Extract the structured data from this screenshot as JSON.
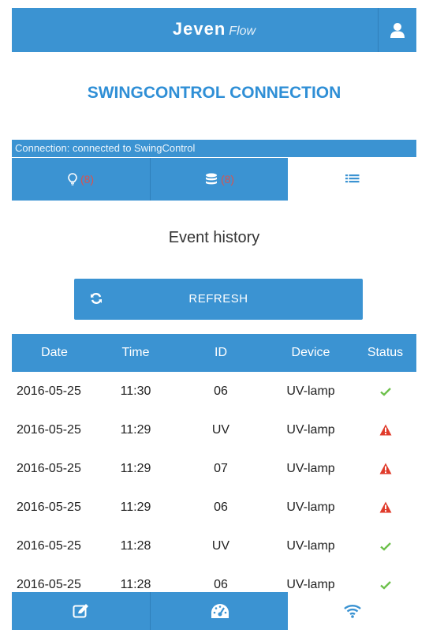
{
  "header": {
    "brand": "Jeven",
    "brand_sub": "Flow",
    "user_icon": "user-icon"
  },
  "page_title": "SWINGCONTROL CONNECTION",
  "connection_status": "Connection: connected to SwingControl",
  "tabs": [
    {
      "icon": "bulb-icon",
      "count": "(8)"
    },
    {
      "icon": "database-icon",
      "count": "(8)"
    },
    {
      "icon": "list-icon",
      "active": true
    }
  ],
  "section_title": "Event history",
  "refresh_label": "REFRESH",
  "table": {
    "headers": [
      "Date",
      "Time",
      "ID",
      "Device",
      "Status"
    ],
    "rows": [
      {
        "date": "2016-05-25",
        "time": "11:30",
        "id": "06",
        "device": "UV-lamp",
        "status": "ok"
      },
      {
        "date": "2016-05-25",
        "time": "11:29",
        "id": "UV",
        "device": "UV-lamp",
        "status": "warning"
      },
      {
        "date": "2016-05-25",
        "time": "11:29",
        "id": "07",
        "device": "UV-lamp",
        "status": "warning"
      },
      {
        "date": "2016-05-25",
        "time": "11:29",
        "id": "06",
        "device": "UV-lamp",
        "status": "warning"
      },
      {
        "date": "2016-05-25",
        "time": "11:28",
        "id": "UV",
        "device": "UV-lamp",
        "status": "ok"
      },
      {
        "date": "2016-05-25",
        "time": "11:28",
        "id": "06",
        "device": "UV-lamp",
        "status": "ok"
      }
    ]
  },
  "bottom_nav": [
    {
      "icon": "edit-icon"
    },
    {
      "icon": "dashboard-icon"
    },
    {
      "icon": "wifi-icon",
      "active": true
    }
  ],
  "colors": {
    "primary": "#3b93d2",
    "title": "#2f8fd6",
    "count": "#d9534f",
    "ok": "#6cc04a",
    "warning": "#e03b2b"
  }
}
